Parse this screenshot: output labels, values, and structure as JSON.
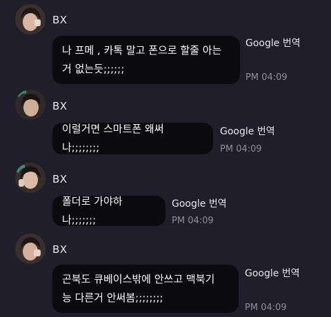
{
  "messages": [
    {
      "sender": "BX",
      "text": "나 프메 , 카톡 말고 폰으로 할줄 아는\n거 없는듯;;;;;;",
      "translate_label": "Google 번역",
      "time": "PM 04:09"
    },
    {
      "sender": "BX",
      "text": "이럴거면 스마트폰 왜써 나;;;;;;;;",
      "translate_label": "Google 번역",
      "time": "PM 04:09"
    },
    {
      "sender": "BX",
      "text": "폴더로 가야하나;;;;;;;",
      "translate_label": "Google 번역",
      "time": "PM 04:09"
    },
    {
      "sender": "BX",
      "text": "곤북도 큐베이스밖에 안쓰고 맥북기\n능 다른거 안써봄;;;;;;;;",
      "translate_label": "Google 번역",
      "time": "PM 04:09"
    }
  ],
  "colors": {
    "background": "#1f1e2a",
    "bubble": "#0b0b0f",
    "meta_text": "#8f8e99"
  }
}
